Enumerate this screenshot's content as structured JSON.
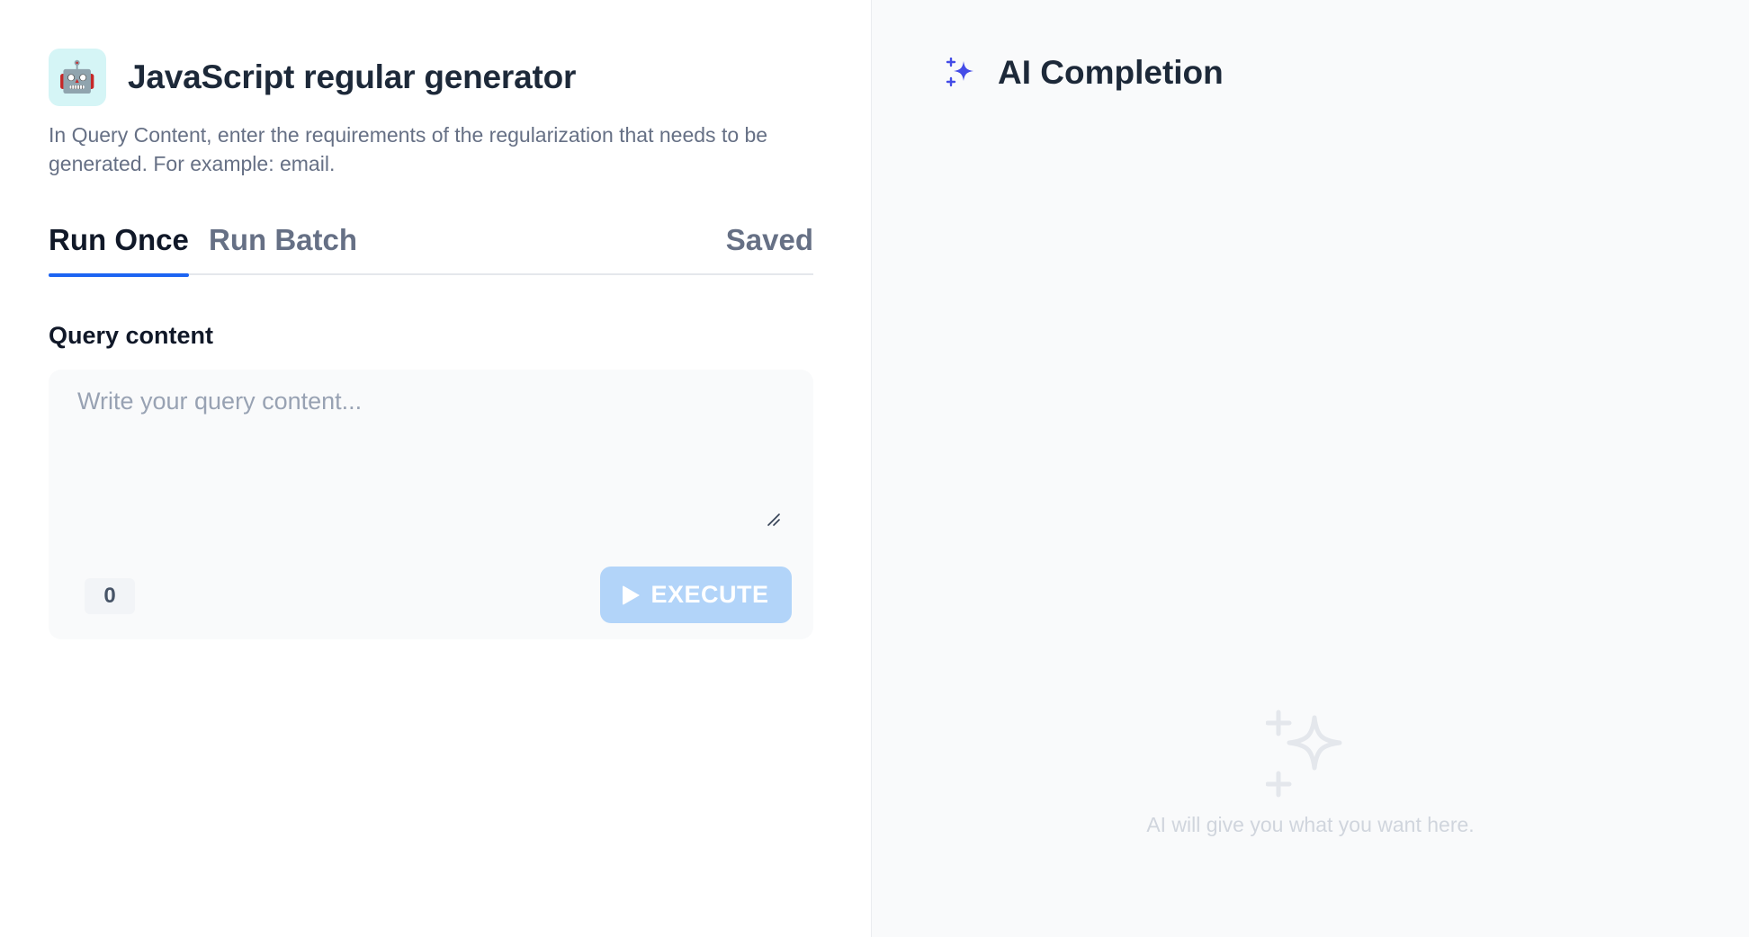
{
  "app": {
    "icon": "🤖",
    "title": "JavaScript regular generator",
    "description": "In Query Content, enter the requirements of the regularization that needs to be generated. For example: email."
  },
  "tabs": {
    "run_once": "Run Once",
    "run_batch": "Run Batch",
    "saved": "Saved",
    "active": "run_once"
  },
  "query": {
    "label": "Query content",
    "placeholder": "Write your query content...",
    "value": "",
    "char_count": "0"
  },
  "execute": {
    "label": "EXECUTE",
    "enabled": false
  },
  "completion": {
    "title": "AI Completion",
    "empty_text": "AI will give you what you want here."
  },
  "colors": {
    "accent": "#1c64f2",
    "sparkle": "#444ce7",
    "execute_disabled": "#b2d4f9",
    "empty_icon": "#e4e7ec"
  },
  "icons": {
    "app": "robot-icon",
    "completion": "sparkle-icon",
    "empty": "sparkle-outline-icon",
    "execute": "play-icon",
    "resize": "resize-handle-icon"
  }
}
